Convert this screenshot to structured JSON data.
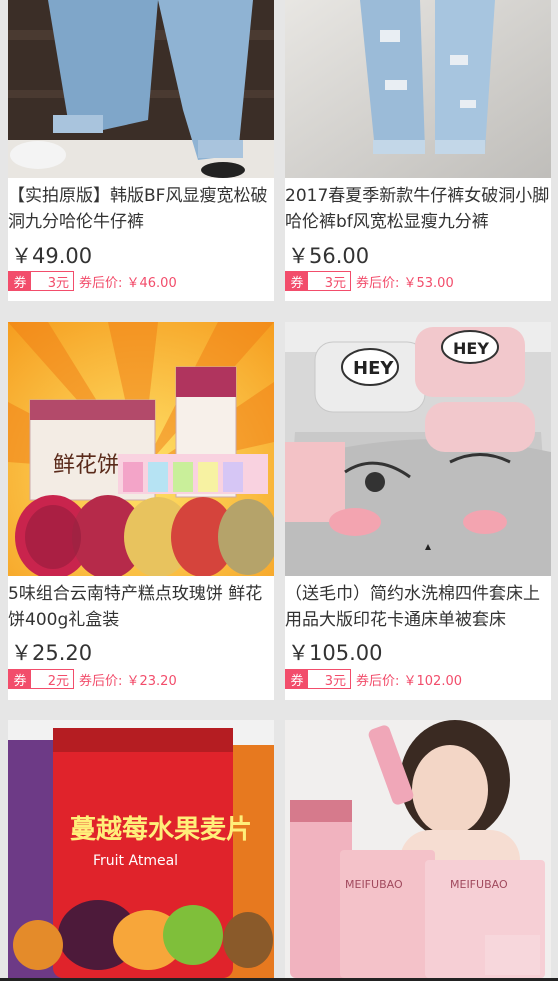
{
  "products": [
    {
      "title": "【实拍原版】韩版BF风显瘦宽松破洞九分哈伦牛仔裤",
      "price": "￥49.00",
      "coupon_tag": "券",
      "coupon_amount": "3元",
      "after_coupon": "券后价: ￥46.00",
      "image": "jeans-photo"
    },
    {
      "title": "2017春夏季新款牛仔裤女破洞小脚哈伦裤bf风宽松显瘦九分裤",
      "price": "￥56.00",
      "coupon_tag": "券",
      "coupon_amount": "3元",
      "after_coupon": "券后价: ￥53.00",
      "image": "ripped-jeans-photo"
    },
    {
      "title": "5味组合云南特产糕点玫瑰饼 鲜花饼400g礼盒装",
      "price": "￥25.20",
      "coupon_tag": "券",
      "coupon_amount": "2元",
      "after_coupon": "券后价: ￥23.20",
      "image": "flower-cake-photo",
      "image_text": "鲜花饼"
    },
    {
      "title": "（送毛巾）简约水洗棉四件套床上用品大版印花卡通床单被套床",
      "price": "￥105.00",
      "coupon_tag": "券",
      "coupon_amount": "3元",
      "after_coupon": "券后价: ￥102.00",
      "image": "bedding-photo",
      "image_text": "HEY"
    },
    {
      "title": "",
      "image": "cranberry-oatmeal-photo",
      "image_text": "蔓越莓水果麦片",
      "image_subtext": "Fruit Atmeal"
    },
    {
      "title": "",
      "image": "cosmetics-photo",
      "image_text": "MEIFUBAO"
    }
  ],
  "colors": {
    "accent": "#f24d6b",
    "background": "#e6e6e6",
    "card": "#ffffff"
  }
}
